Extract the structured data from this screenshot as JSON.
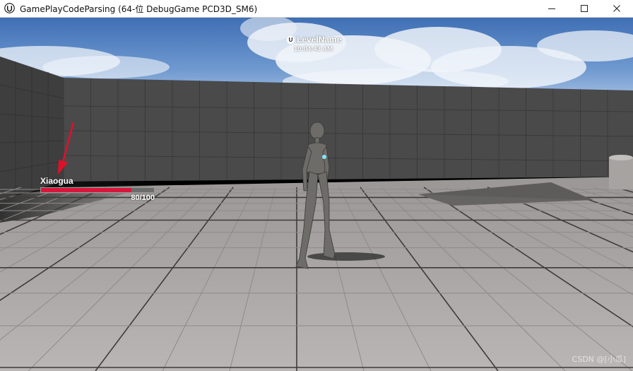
{
  "window": {
    "title": "GamePlayCodeParsing    (64-位 DebugGame PCD3D_SM6)",
    "app_icon": "unreal-engine-logo",
    "controls": [
      "minimize-icon",
      "maximize-icon",
      "close-icon"
    ]
  },
  "hud": {
    "level_icon": "U",
    "level_name": "LevelName",
    "time": "10:04:43 AM"
  },
  "player": {
    "name": "Xiaogua",
    "health_current": 80,
    "health_max": 100,
    "health_text": "80/100",
    "health_fraction": 0.8,
    "bar_color": "#d9163a"
  },
  "annotation": {
    "arrow_color": "#e0102a",
    "points_to": "player-name"
  },
  "watermark": "CSDN @[小瓜]"
}
